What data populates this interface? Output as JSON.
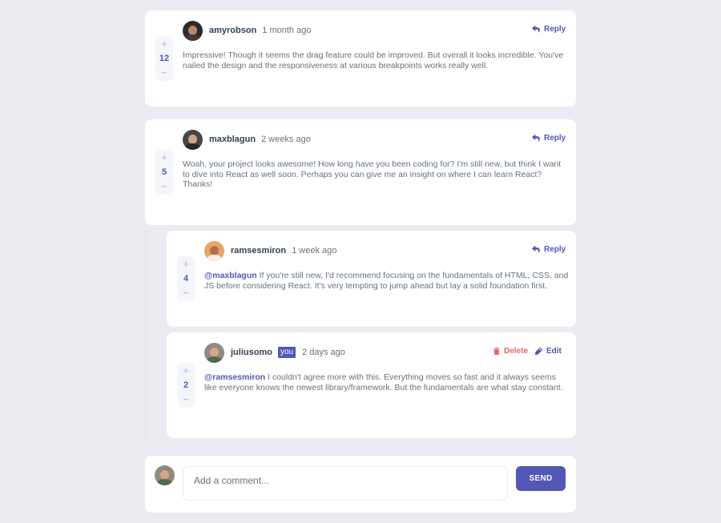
{
  "colors": {
    "accent": "#5357b6",
    "accent_light": "#c5c6ef",
    "danger": "#ed6368",
    "heading": "#324152",
    "body_text": "#67727e",
    "background": "#eaecf1"
  },
  "comments": [
    {
      "user": "amyrobson",
      "time": "1 month ago",
      "score": "12",
      "reply_label": "Reply",
      "text": "Impressive! Though it seems the drag feature could be improved. But overall it looks incredible. You've nailed the design and the responsiveness at various breakpoints works really well."
    },
    {
      "user": "maxblagun",
      "time": "2 weeks ago",
      "score": "5",
      "reply_label": "Reply",
      "text": "Woah, your project looks awesome! How long have you been coding for? I'm still new, but think I want to dive into React as well soon. Perhaps you can give me an insight on where I can learn React? Thanks!"
    }
  ],
  "replies": [
    {
      "user": "ramsesmiron",
      "time": "1 week ago",
      "score": "4",
      "reply_label": "Reply",
      "mention": "@maxblagun",
      "text": "If you're still new, I'd recommend focusing on the fundamentals of HTML, CSS, and JS before considering React. It's very tempting to jump ahead but lay a solid foundation first."
    },
    {
      "user": "juliusomo",
      "you_badge": "you",
      "time": "2 days ago",
      "score": "2",
      "delete_label": "Delete",
      "edit_label": "Edit",
      "mention": "@ramsesmiron",
      "text": "I couldn't agree more with this. Everything moves so fast and it always seems like everyone knows the newest library/framework. But the fundamentals are what stay constant."
    }
  ],
  "composer": {
    "placeholder": "Add a comment...",
    "send_label": "SEND"
  },
  "icons": {
    "plus": "+",
    "minus": "−",
    "reply": "reply-icon",
    "delete": "trash-icon",
    "edit": "pencil-icon"
  }
}
